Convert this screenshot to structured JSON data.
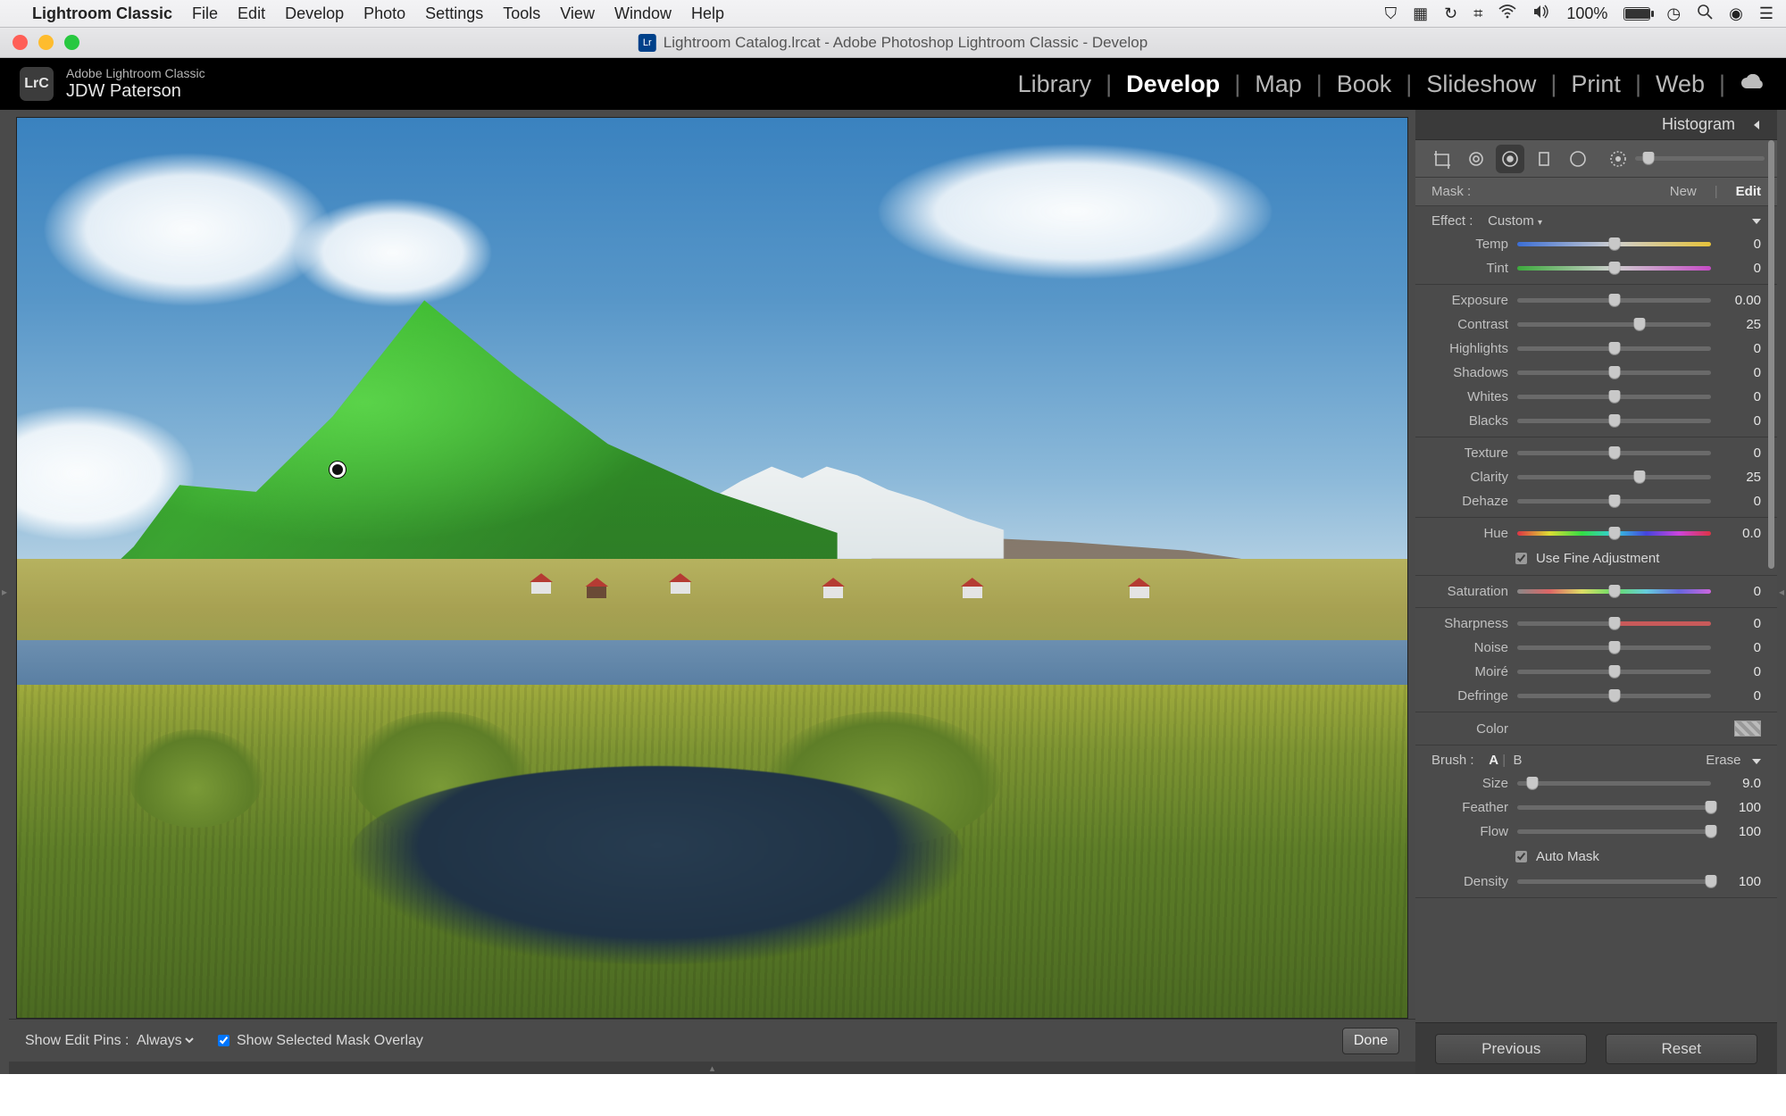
{
  "menubar": {
    "app_name": "Lightroom Classic",
    "menus": [
      "File",
      "Edit",
      "Develop",
      "Photo",
      "Settings",
      "Tools",
      "View",
      "Window",
      "Help"
    ],
    "battery_pct": "100%"
  },
  "titlebar": {
    "title": "Lightroom Catalog.lrcat - Adobe Photoshop Lightroom Classic - Develop"
  },
  "identity": {
    "product": "Adobe Lightroom Classic",
    "user": "JDW Paterson",
    "badge": "LrC"
  },
  "modules": {
    "items": [
      "Library",
      "Develop",
      "Map",
      "Book",
      "Slideshow",
      "Print",
      "Web"
    ],
    "active": "Develop"
  },
  "rightpanel": {
    "header": "Histogram",
    "mask_label": "Mask :",
    "mask_new": "New",
    "mask_edit": "Edit",
    "effect_label": "Effect :",
    "effect_value": "Custom",
    "sliders": [
      {
        "label": "Temp",
        "value": "0",
        "pos": 50,
        "cls": "temp"
      },
      {
        "label": "Tint",
        "value": "0",
        "pos": 50,
        "cls": "tint"
      }
    ],
    "tone": [
      {
        "label": "Exposure",
        "value": "0.00",
        "pos": 50
      },
      {
        "label": "Contrast",
        "value": "25",
        "pos": 63
      },
      {
        "label": "Highlights",
        "value": "0",
        "pos": 50
      },
      {
        "label": "Shadows",
        "value": "0",
        "pos": 50
      },
      {
        "label": "Whites",
        "value": "0",
        "pos": 50
      },
      {
        "label": "Blacks",
        "value": "0",
        "pos": 50
      }
    ],
    "presence": [
      {
        "label": "Texture",
        "value": "0",
        "pos": 50
      },
      {
        "label": "Clarity",
        "value": "25",
        "pos": 63
      },
      {
        "label": "Dehaze",
        "value": "0",
        "pos": 50
      }
    ],
    "hue": {
      "label": "Hue",
      "value": "0.0",
      "pos": 50
    },
    "fine_adj": "Use Fine Adjustment",
    "sat": {
      "label": "Saturation",
      "value": "0",
      "pos": 50
    },
    "detail": [
      {
        "label": "Sharpness",
        "value": "0",
        "pos": 50,
        "cls": "sharp"
      },
      {
        "label": "Noise",
        "value": "0",
        "pos": 50
      },
      {
        "label": "Moiré",
        "value": "0",
        "pos": 50
      },
      {
        "label": "Defringe",
        "value": "0",
        "pos": 50
      }
    ],
    "color_label": "Color",
    "brush": {
      "header": "Brush :",
      "a": "A",
      "b": "B",
      "erase": "Erase",
      "rows": [
        {
          "label": "Size",
          "value": "9.0",
          "pos": 8
        },
        {
          "label": "Feather",
          "value": "100",
          "pos": 100
        },
        {
          "label": "Flow",
          "value": "100",
          "pos": 100
        }
      ],
      "automask": "Auto Mask",
      "density": {
        "label": "Density",
        "value": "100",
        "pos": 100
      }
    },
    "prev": "Previous",
    "reset": "Reset"
  },
  "canvasfooter": {
    "pins_label": "Show Edit Pins :",
    "pins_value": "Always",
    "overlay": "Show Selected Mask Overlay",
    "done": "Done"
  }
}
